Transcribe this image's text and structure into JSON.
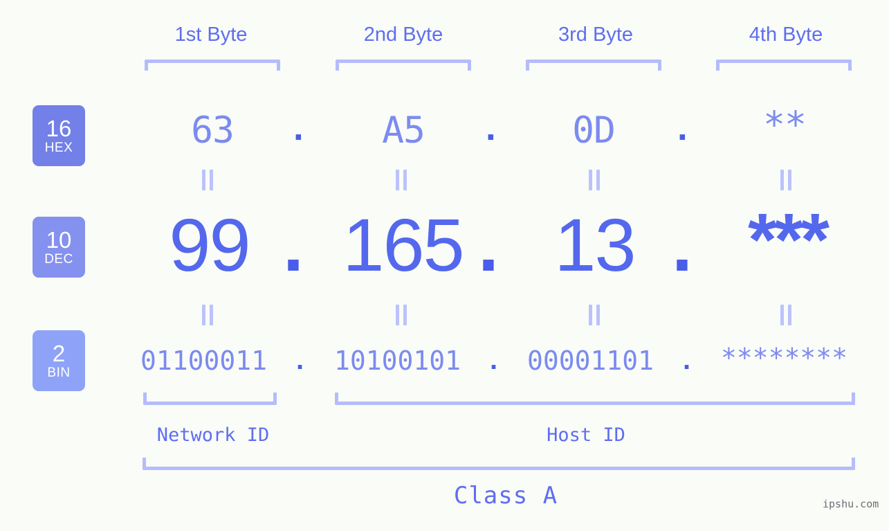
{
  "page": {
    "background_color": "#fafcf8",
    "accent_color": "#5468ed",
    "light_accent_color": "#b5bcfb",
    "mid_accent_color": "#7b8bef"
  },
  "byte_headers": [
    {
      "label": "1st Byte"
    },
    {
      "label": "2nd Byte"
    },
    {
      "label": "3rd Byte"
    },
    {
      "label": "4th Byte"
    }
  ],
  "rows": {
    "hex": {
      "badge_number": "16",
      "badge_name": "HEX",
      "badge_color": "#7280e8",
      "values": [
        "63",
        "A5",
        "0D",
        "**"
      ],
      "separator": "."
    },
    "dec": {
      "badge_number": "10",
      "badge_name": "DEC",
      "badge_color": "#8591ef",
      "values": [
        "99",
        "165",
        "13",
        "***"
      ],
      "separator": "."
    },
    "bin": {
      "badge_number": "2",
      "badge_name": "BIN",
      "badge_color": "#8ea3f7",
      "values": [
        "01100011",
        "10100101",
        "00001101",
        "********"
      ],
      "separator": "."
    }
  },
  "equals_marker": "=",
  "id_labels": {
    "network": "Network ID",
    "host": "Host ID"
  },
  "class_label": "Class A",
  "watermark": "ipshu.com"
}
